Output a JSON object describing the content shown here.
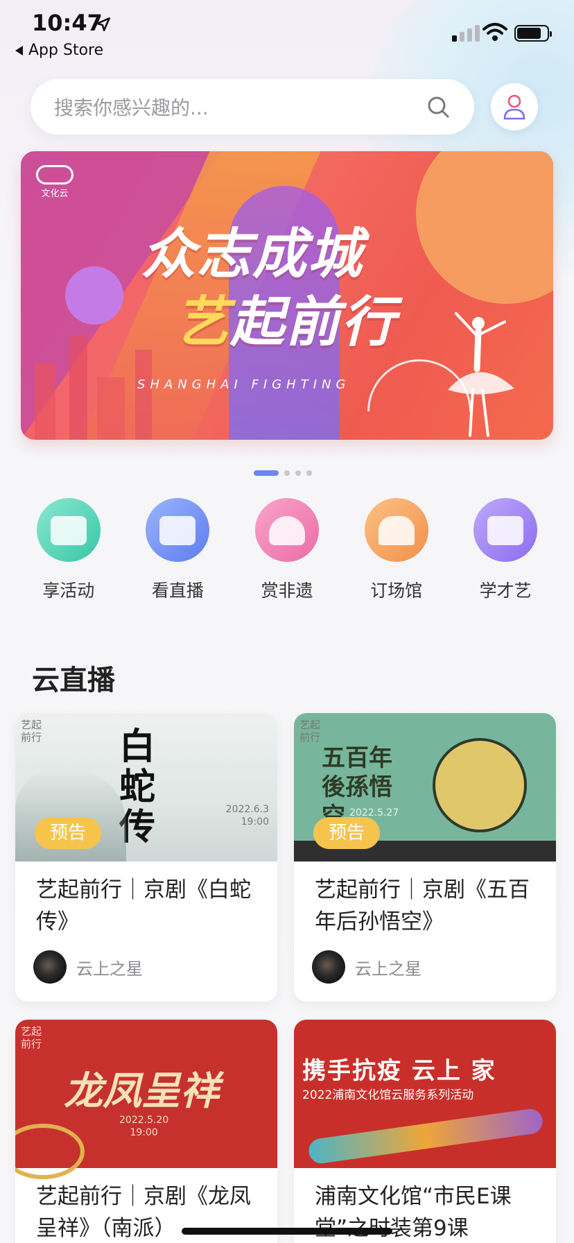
{
  "status_bar": {
    "time": "10:47",
    "back_app": "App Store"
  },
  "search": {
    "placeholder": "搜索你感兴趣的..."
  },
  "banner": {
    "logo_text": "文化云",
    "title_line1": "众志成城",
    "title_line2_highlight": "艺",
    "title_line2_rest": "起前行",
    "subtitle": "SHANGHAI FIGHTING",
    "page_count": 4,
    "active_page": 1
  },
  "quick_entries": [
    {
      "label": "享活动",
      "icon": "ticket-icon",
      "color": "#4fd3b5"
    },
    {
      "label": "看直播",
      "icon": "live-screen-icon",
      "color": "#6f8ff3"
    },
    {
      "label": "赏非遗",
      "icon": "fan-icon",
      "color": "#f07fb1"
    },
    {
      "label": "订场馆",
      "icon": "temple-icon",
      "color": "#f7a35b"
    },
    {
      "label": "学才艺",
      "icon": "tv-play-icon",
      "color": "#9a7cf5"
    }
  ],
  "section": {
    "title": "云直播"
  },
  "cards": [
    {
      "title": "艺起前行｜京剧《白蛇传》",
      "tag": "预告",
      "author": "云上之星",
      "poster_text": "白蛇传",
      "poster_date": "2022.6.3",
      "poster_time": "19:00",
      "corner_mark": "艺起前行"
    },
    {
      "title": "艺起前行｜京剧《五百年后孙悟空》",
      "tag": "预告",
      "author": "云上之星",
      "poster_text": "五百年後孫悟空",
      "poster_date": "2022.5.27",
      "corner_mark": "艺起前行"
    },
    {
      "title": "艺起前行｜京剧《龙凤呈祥》（南派）",
      "poster_text": "龙凤呈祥",
      "poster_date": "2022.5.20",
      "poster_time": "19:00",
      "corner_mark": "艺起前行"
    },
    {
      "title": "浦南文化馆“市民E课堂”之时装第9课",
      "poster_headline": "携手抗疫 云上 家",
      "poster_sub": "2022浦南文化馆云服务系列活动"
    }
  ]
}
